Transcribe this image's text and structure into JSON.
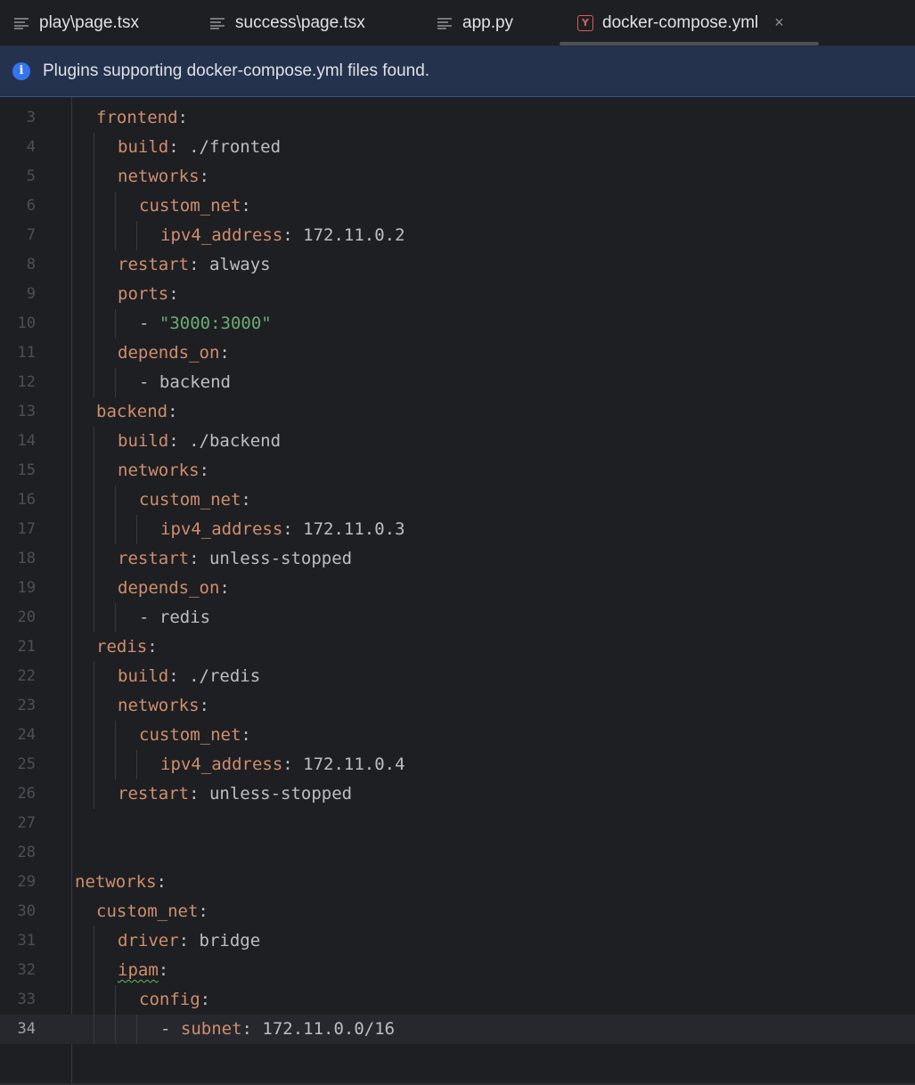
{
  "tabs": [
    {
      "label": "play\\page.tsx",
      "icon": "text-file-icon",
      "active": false
    },
    {
      "label": "success\\page.tsx",
      "icon": "text-file-icon",
      "active": false
    },
    {
      "label": "app.py",
      "icon": "text-file-icon",
      "active": false
    },
    {
      "label": "docker-compose.yml",
      "icon": "yaml-file-icon",
      "active": true,
      "close_glyph": "×"
    }
  ],
  "banner": {
    "icon": "info-icon",
    "text": "Plugins supporting docker-compose.yml files found."
  },
  "editor": {
    "current_line": 34,
    "lines": [
      {
        "n": "3",
        "indent": 1,
        "tokens": [
          {
            "t": "frontend",
            "c": "key"
          },
          {
            "t": ":",
            "c": "val"
          }
        ]
      },
      {
        "n": "4",
        "indent": 2,
        "tokens": [
          {
            "t": "build",
            "c": "key"
          },
          {
            "t": ": ./fronted",
            "c": "val"
          }
        ]
      },
      {
        "n": "5",
        "indent": 2,
        "tokens": [
          {
            "t": "networks",
            "c": "key"
          },
          {
            "t": ":",
            "c": "val"
          }
        ]
      },
      {
        "n": "6",
        "indent": 3,
        "tokens": [
          {
            "t": "custom_net",
            "c": "key"
          },
          {
            "t": ":",
            "c": "val"
          }
        ]
      },
      {
        "n": "7",
        "indent": 4,
        "tokens": [
          {
            "t": "ipv4_address",
            "c": "key"
          },
          {
            "t": ": 172.11.0.2",
            "c": "val"
          }
        ]
      },
      {
        "n": "8",
        "indent": 2,
        "tokens": [
          {
            "t": "restart",
            "c": "key"
          },
          {
            "t": ": always",
            "c": "val"
          }
        ]
      },
      {
        "n": "9",
        "indent": 2,
        "tokens": [
          {
            "t": "ports",
            "c": "key"
          },
          {
            "t": ":",
            "c": "val"
          }
        ]
      },
      {
        "n": "10",
        "indent": 3,
        "tokens": [
          {
            "t": "- ",
            "c": "val"
          },
          {
            "t": "\"3000:3000\"",
            "c": "str"
          }
        ]
      },
      {
        "n": "11",
        "indent": 2,
        "tokens": [
          {
            "t": "depends_on",
            "c": "key"
          },
          {
            "t": ":",
            "c": "val"
          }
        ]
      },
      {
        "n": "12",
        "indent": 3,
        "tokens": [
          {
            "t": "- backend",
            "c": "val"
          }
        ]
      },
      {
        "n": "13",
        "indent": 1,
        "tokens": [
          {
            "t": "backend",
            "c": "key"
          },
          {
            "t": ":",
            "c": "val"
          }
        ]
      },
      {
        "n": "14",
        "indent": 2,
        "tokens": [
          {
            "t": "build",
            "c": "key"
          },
          {
            "t": ": ./backend",
            "c": "val"
          }
        ]
      },
      {
        "n": "15",
        "indent": 2,
        "tokens": [
          {
            "t": "networks",
            "c": "key"
          },
          {
            "t": ":",
            "c": "val"
          }
        ]
      },
      {
        "n": "16",
        "indent": 3,
        "tokens": [
          {
            "t": "custom_net",
            "c": "key"
          },
          {
            "t": ":",
            "c": "val"
          }
        ]
      },
      {
        "n": "17",
        "indent": 4,
        "tokens": [
          {
            "t": "ipv4_address",
            "c": "key"
          },
          {
            "t": ": 172.11.0.3",
            "c": "val"
          }
        ]
      },
      {
        "n": "18",
        "indent": 2,
        "tokens": [
          {
            "t": "restart",
            "c": "key"
          },
          {
            "t": ": unless-stopped",
            "c": "val"
          }
        ]
      },
      {
        "n": "19",
        "indent": 2,
        "tokens": [
          {
            "t": "depends_on",
            "c": "key"
          },
          {
            "t": ":",
            "c": "val"
          }
        ]
      },
      {
        "n": "20",
        "indent": 3,
        "tokens": [
          {
            "t": "- redis",
            "c": "val"
          }
        ]
      },
      {
        "n": "21",
        "indent": 1,
        "tokens": [
          {
            "t": "redis",
            "c": "key"
          },
          {
            "t": ":",
            "c": "val"
          }
        ]
      },
      {
        "n": "22",
        "indent": 2,
        "tokens": [
          {
            "t": "build",
            "c": "key"
          },
          {
            "t": ": ./redis",
            "c": "val"
          }
        ]
      },
      {
        "n": "23",
        "indent": 2,
        "tokens": [
          {
            "t": "networks",
            "c": "key"
          },
          {
            "t": ":",
            "c": "val"
          }
        ]
      },
      {
        "n": "24",
        "indent": 3,
        "tokens": [
          {
            "t": "custom_net",
            "c": "key"
          },
          {
            "t": ":",
            "c": "val"
          }
        ]
      },
      {
        "n": "25",
        "indent": 4,
        "tokens": [
          {
            "t": "ipv4_address",
            "c": "key"
          },
          {
            "t": ": 172.11.0.4",
            "c": "val"
          }
        ]
      },
      {
        "n": "26",
        "indent": 2,
        "tokens": [
          {
            "t": "restart",
            "c": "key"
          },
          {
            "t": ": unless-stopped",
            "c": "val"
          }
        ]
      },
      {
        "n": "27",
        "indent": 0,
        "tokens": []
      },
      {
        "n": "28",
        "indent": 0,
        "tokens": []
      },
      {
        "n": "29",
        "indent": 0,
        "tokens": [
          {
            "t": "networks",
            "c": "key"
          },
          {
            "t": ":",
            "c": "val"
          }
        ]
      },
      {
        "n": "30",
        "indent": 1,
        "tokens": [
          {
            "t": "custom_net",
            "c": "key"
          },
          {
            "t": ":",
            "c": "val"
          }
        ]
      },
      {
        "n": "31",
        "indent": 2,
        "tokens": [
          {
            "t": "driver",
            "c": "key"
          },
          {
            "t": ": bridge",
            "c": "val"
          }
        ]
      },
      {
        "n": "32",
        "indent": 2,
        "tokens": [
          {
            "t": "ipam",
            "c": "key typo"
          },
          {
            "t": ":",
            "c": "val"
          }
        ]
      },
      {
        "n": "33",
        "indent": 3,
        "tokens": [
          {
            "t": "config",
            "c": "key"
          },
          {
            "t": ":",
            "c": "val"
          }
        ]
      },
      {
        "n": "34",
        "indent": 4,
        "tokens": [
          {
            "t": "- ",
            "c": "val"
          },
          {
            "t": "subnet",
            "c": "key"
          },
          {
            "t": ": 172.11.0.0/16",
            "c": "val"
          }
        ]
      }
    ]
  }
}
